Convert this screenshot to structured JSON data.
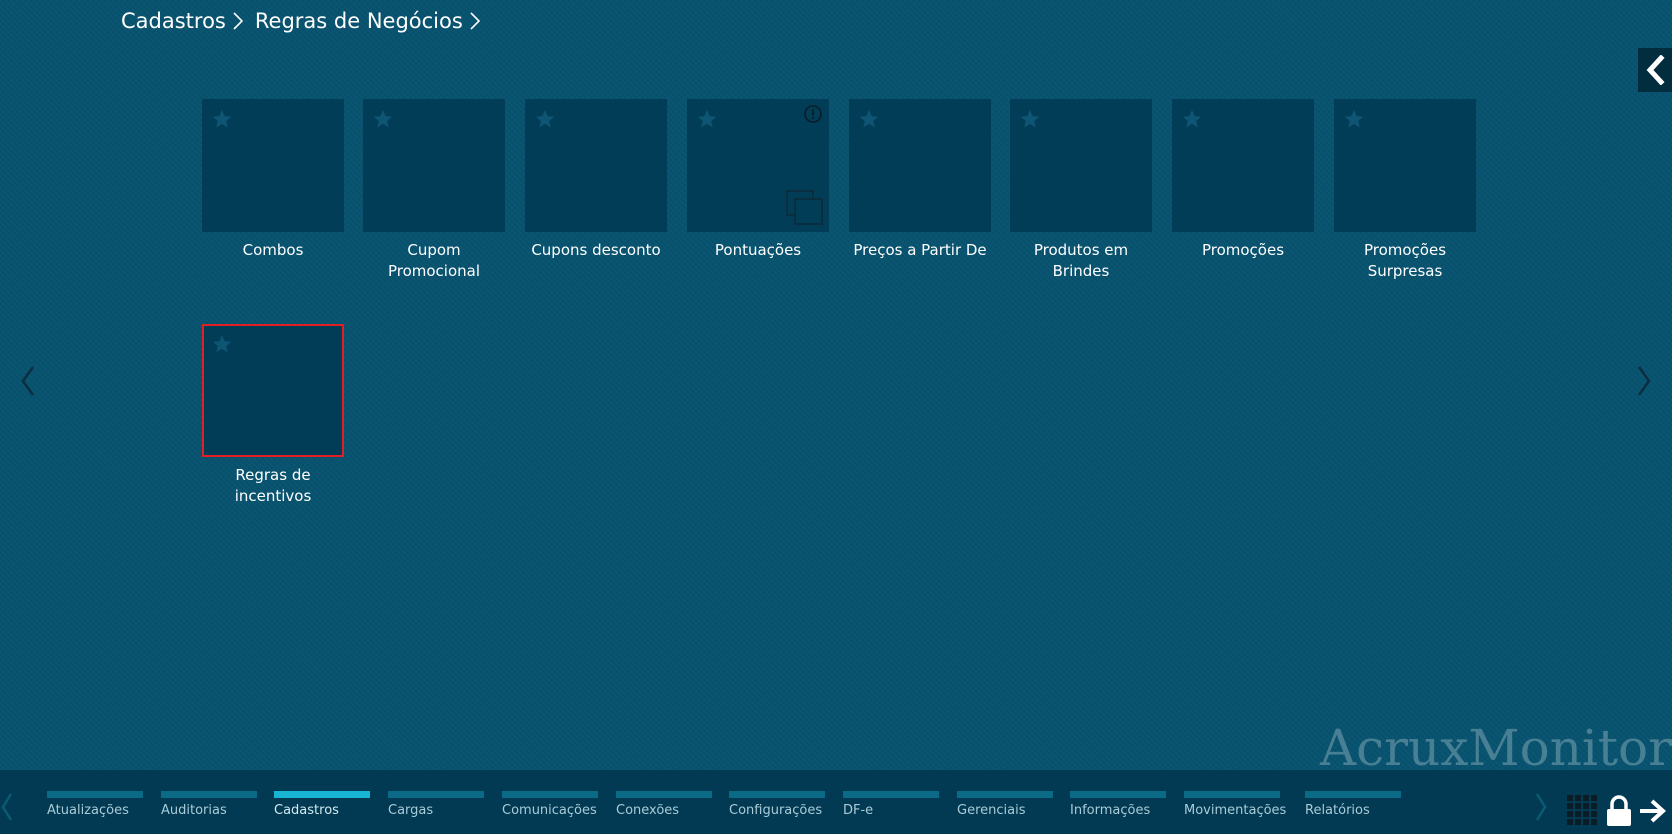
{
  "breadcrumb": [
    "Cadastros",
    "Regras de Negócios"
  ],
  "tiles": [
    {
      "label": "Combos"
    },
    {
      "label": "Cupom Promocional"
    },
    {
      "label": "Cupons desconto"
    },
    {
      "label": "Pontuações"
    },
    {
      "label": "Preços a Partir De"
    },
    {
      "label": "Produtos em Brindes"
    },
    {
      "label": "Promoções"
    },
    {
      "label": "Promoções Surpresas"
    },
    {
      "label": "Regras de incentivos"
    }
  ],
  "watermark": "AcruxMonitor",
  "taskbar": [
    {
      "label": "Atualizações"
    },
    {
      "label": "Auditorias"
    },
    {
      "label": "Cadastros",
      "active": true
    },
    {
      "label": "Cargas"
    },
    {
      "label": "Comunicações"
    },
    {
      "label": "Conexões"
    },
    {
      "label": "Configurações"
    },
    {
      "label": "DF-e"
    },
    {
      "label": "Gerenciais"
    },
    {
      "label": "Informações"
    },
    {
      "label": "Movimentações"
    },
    {
      "label": "Relatórios"
    }
  ],
  "colors": {
    "background": "#07536f",
    "tile": "#013d56",
    "selected_border": "#e31e24",
    "taskbar": "#013a52",
    "taskbar_active": "#18b4d4"
  },
  "icons": [
    "chevron-right-icon",
    "chevron-left-icon",
    "star-icon",
    "info-icon",
    "multi-window-icon",
    "grid-icon",
    "lock-icon",
    "exit-arrow-icon"
  ]
}
